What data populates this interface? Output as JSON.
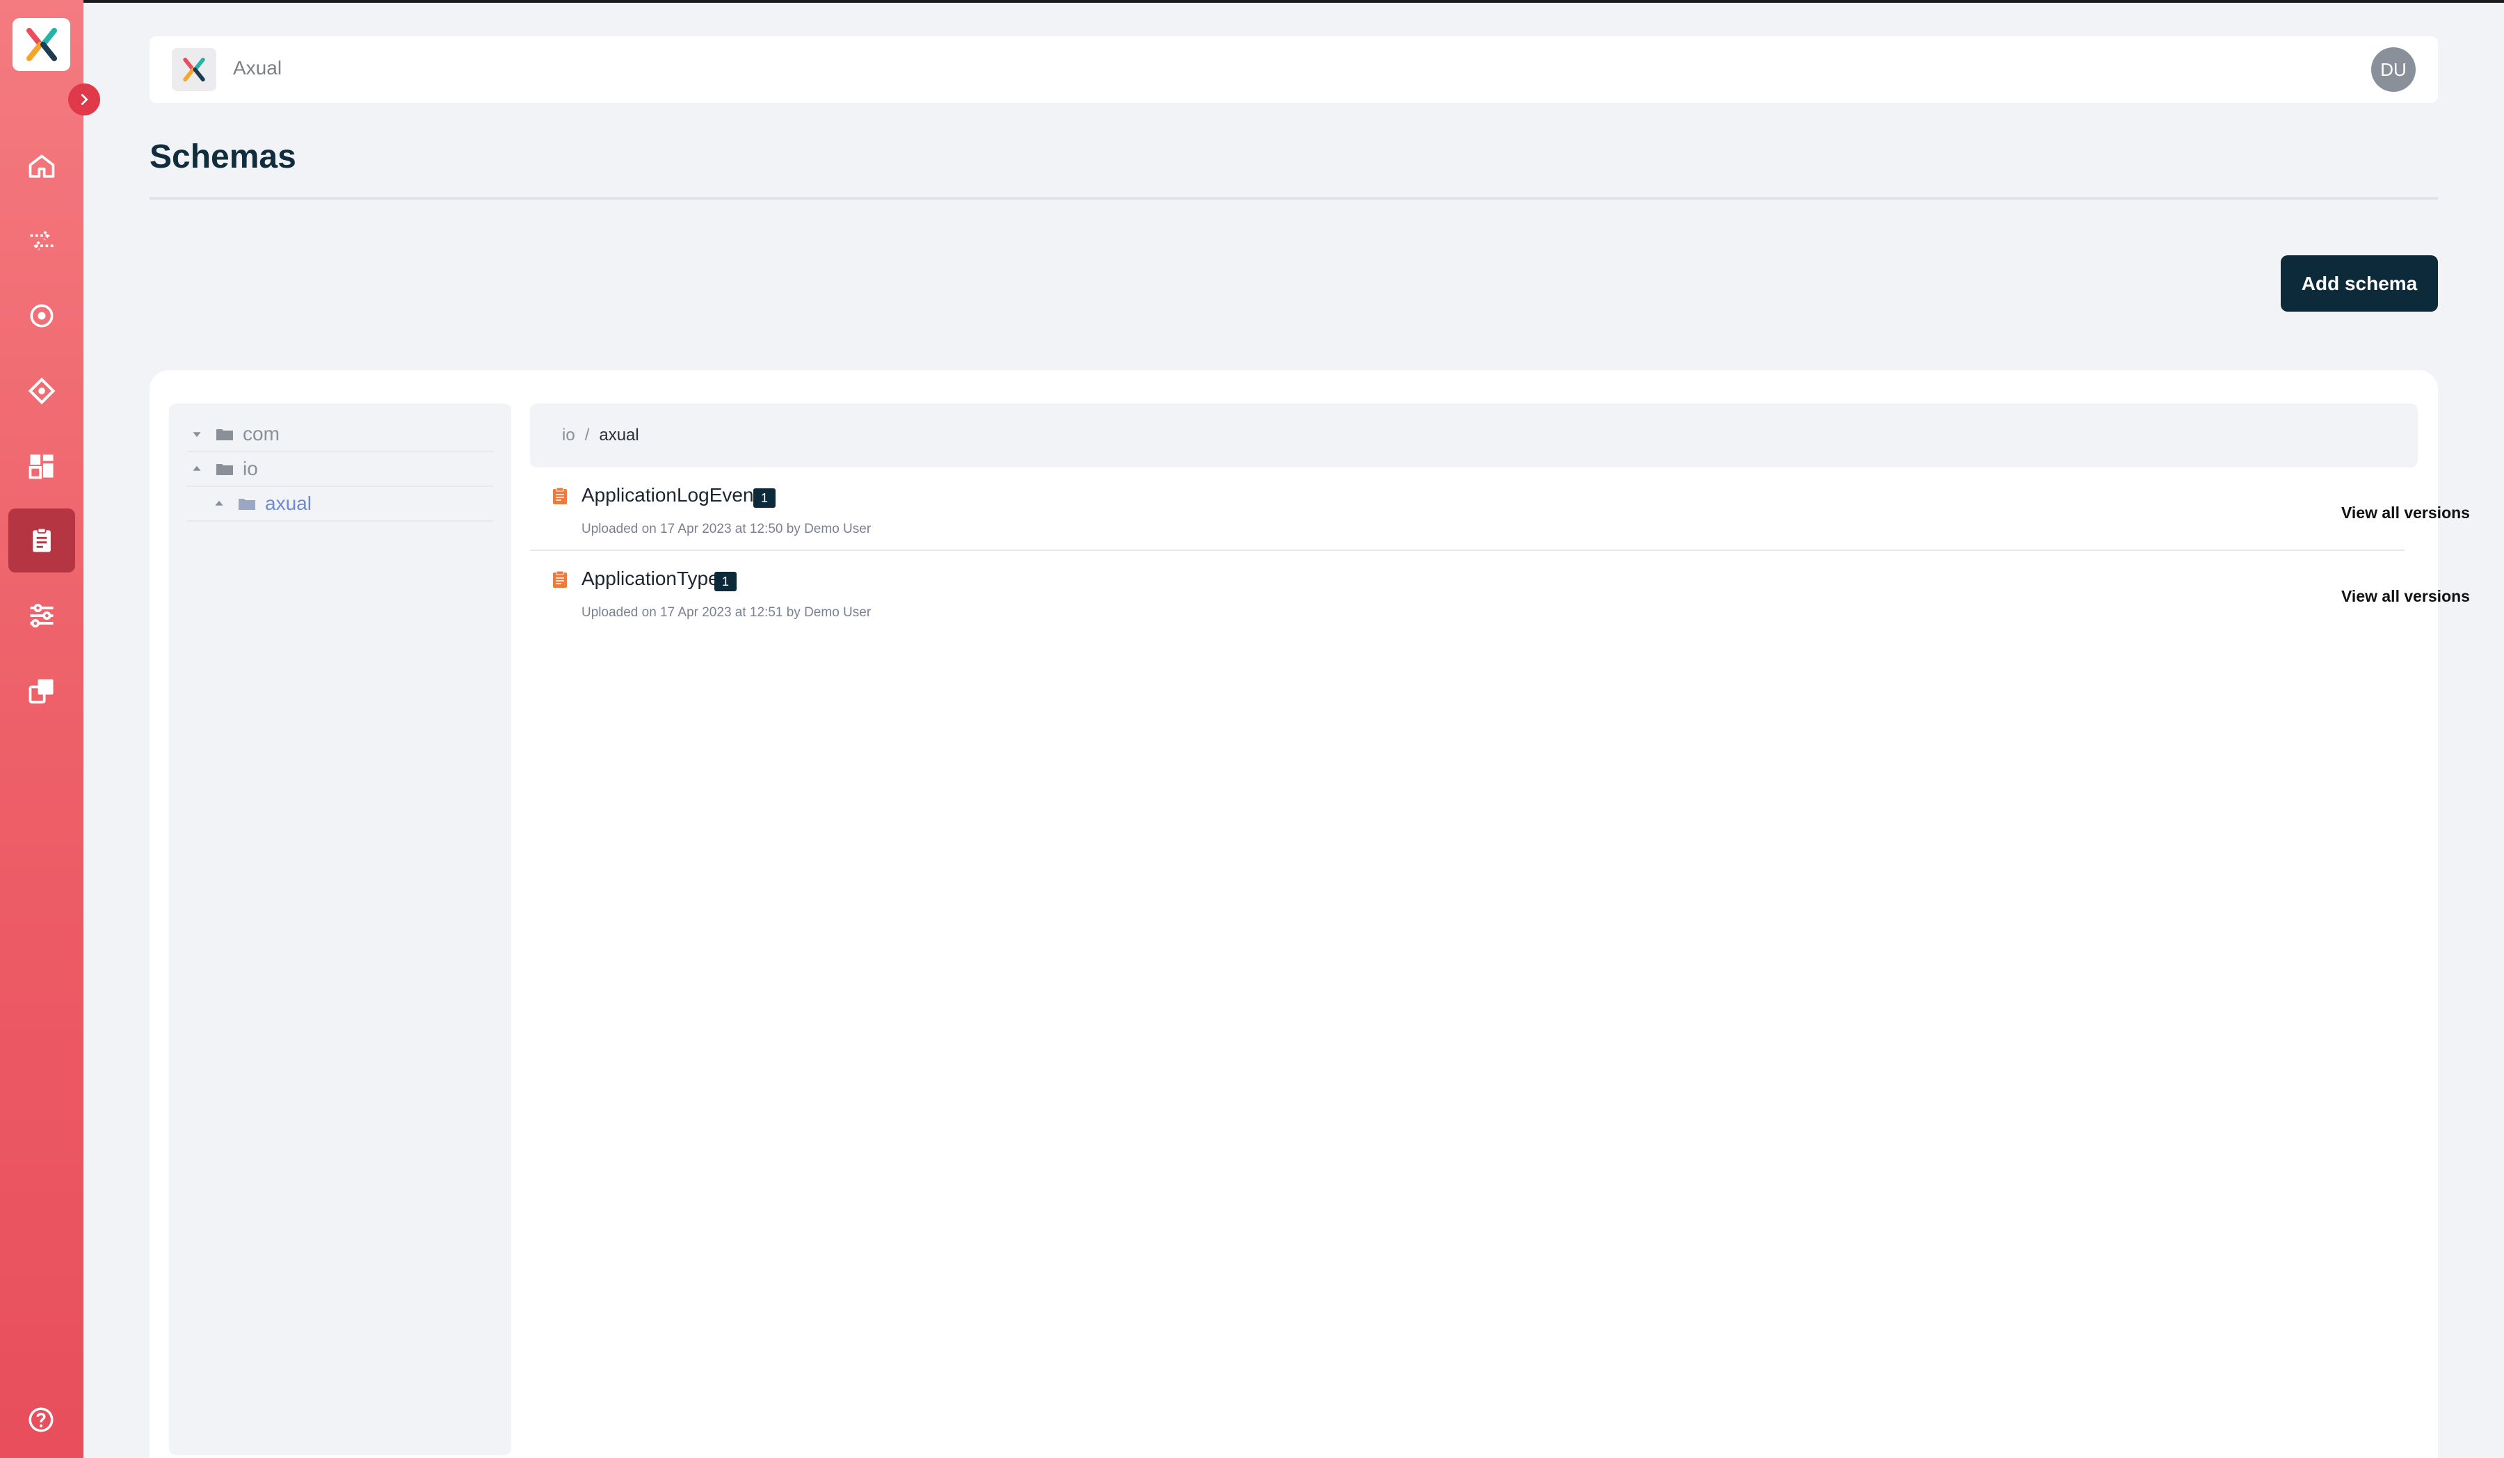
{
  "app": {
    "name": "Axual"
  },
  "user": {
    "initials": "DU"
  },
  "page": {
    "title": "Schemas"
  },
  "actions": {
    "add_schema": "Add schema"
  },
  "sidebar": {
    "items": [
      {
        "icon": "home-icon",
        "active": false
      },
      {
        "icon": "streams-icon",
        "active": false
      },
      {
        "icon": "target-icon",
        "active": false
      },
      {
        "icon": "applications-icon",
        "active": false
      },
      {
        "icon": "dashboard-icon",
        "active": false
      },
      {
        "icon": "schemas-clipboard-icon",
        "active": true
      },
      {
        "icon": "settings-sliders-icon",
        "active": false
      },
      {
        "icon": "environments-icon",
        "active": false
      }
    ],
    "help_icon": "help-icon"
  },
  "tree": {
    "nodes": [
      {
        "label": "com",
        "expanded": false,
        "depth": 0
      },
      {
        "label": "io",
        "expanded": true,
        "depth": 0
      },
      {
        "label": "axual",
        "expanded": true,
        "depth": 1,
        "selected": true
      }
    ]
  },
  "breadcrumb": {
    "items": [
      "io"
    ],
    "separator": "/",
    "current": "axual"
  },
  "schemas": [
    {
      "name": "ApplicationLogEvent",
      "version": "1",
      "meta": "Uploaded on 17 Apr 2023 at 12:50 by Demo User",
      "link": "View all versions"
    },
    {
      "name": "ApplicationType",
      "version": "1",
      "meta": "Uploaded on 17 Apr 2023 at 12:51 by Demo User",
      "link": "View all versions"
    }
  ],
  "colors": {
    "sidebar_top": "#f47b80",
    "sidebar_bottom": "#e84e5c",
    "primary_dark": "#0d2a3b",
    "schema_icon": "#f07a3a"
  }
}
